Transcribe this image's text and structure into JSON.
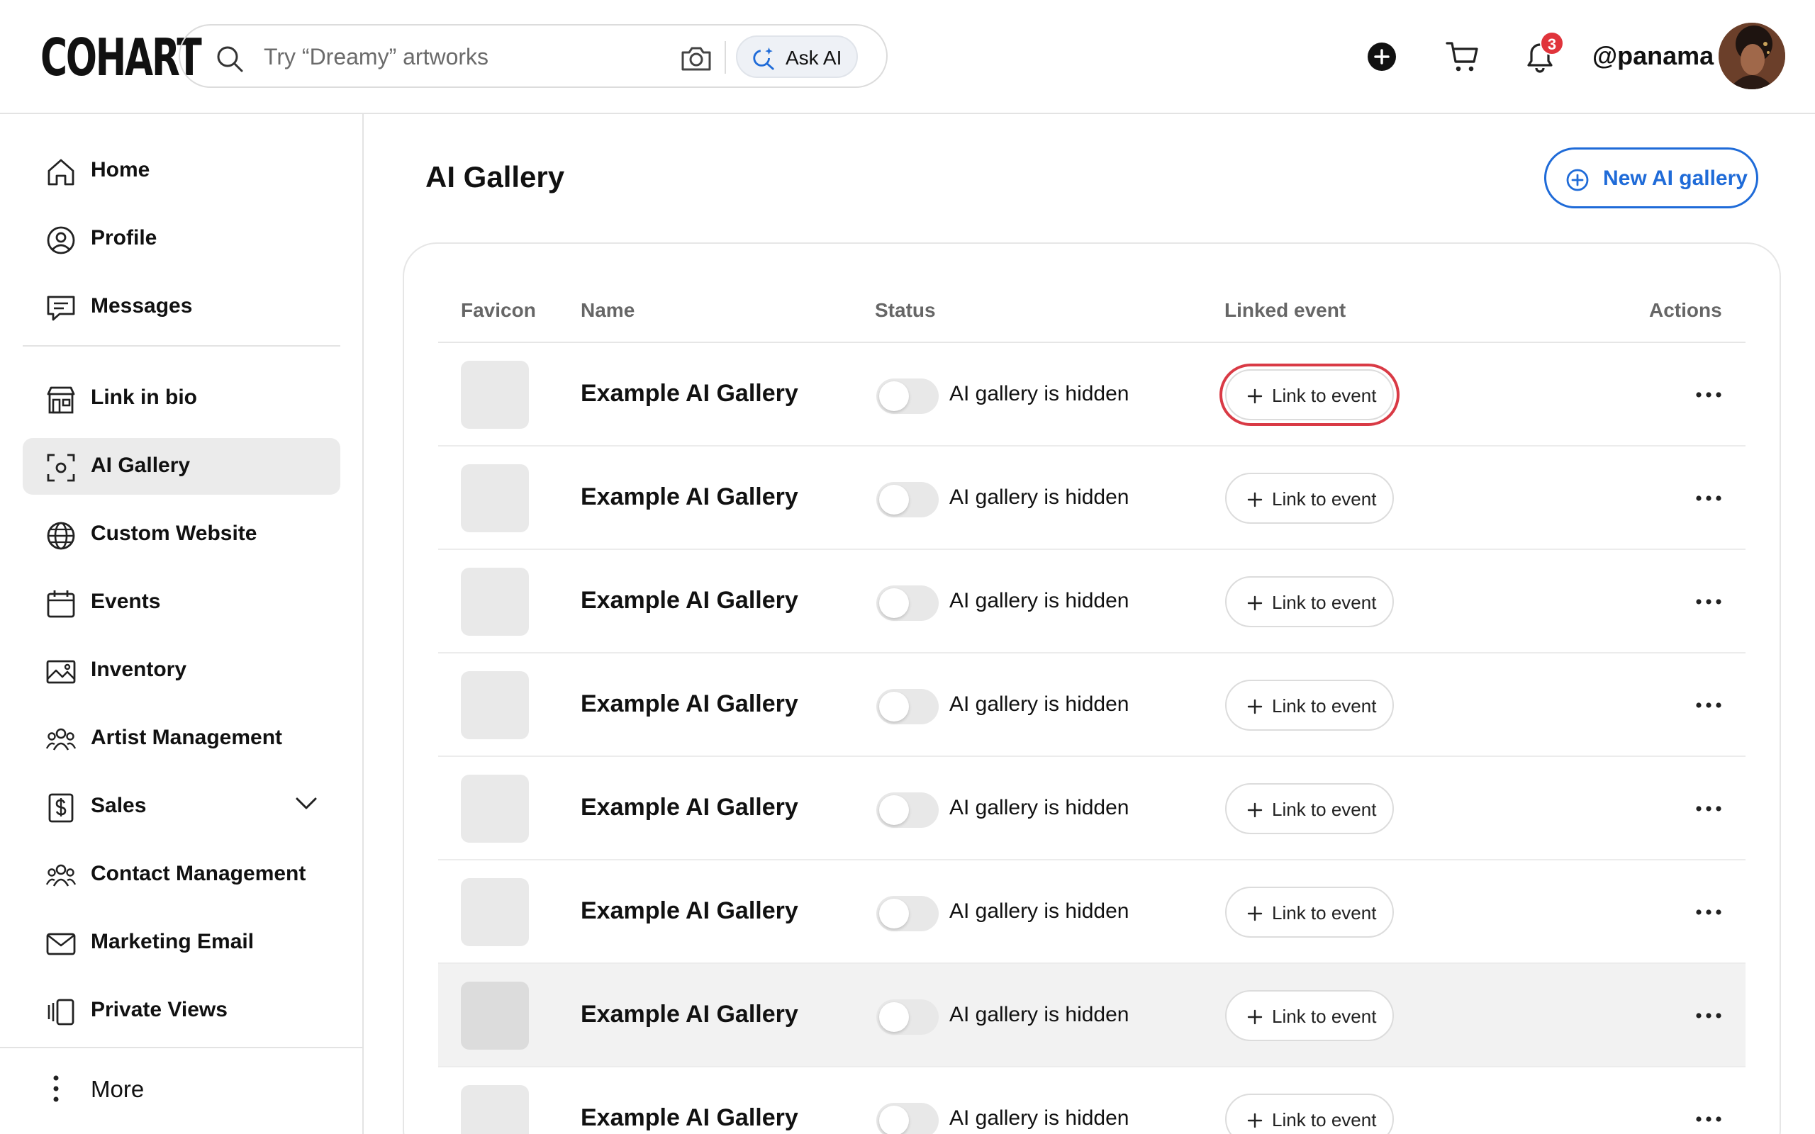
{
  "app": {
    "logo": "COHART"
  },
  "header": {
    "search_placeholder": "Try “Dreamy” artworks",
    "ask_ai_label": "Ask AI",
    "notification_count": "3",
    "username": "@panama"
  },
  "sidebar": {
    "items": [
      {
        "label": "Home",
        "icon": "home-icon"
      },
      {
        "label": "Profile",
        "icon": "profile-icon"
      },
      {
        "label": "Messages",
        "icon": "messages-icon"
      },
      {
        "label": "Link in bio",
        "icon": "storefront-icon"
      },
      {
        "label": "AI Gallery",
        "icon": "ai-scan-icon",
        "active": true
      },
      {
        "label": "Custom Website",
        "icon": "globe-icon"
      },
      {
        "label": "Events",
        "icon": "calendar-icon"
      },
      {
        "label": "Inventory",
        "icon": "image-icon"
      },
      {
        "label": "Artist Management",
        "icon": "people-icon"
      },
      {
        "label": "Sales",
        "icon": "dollar-doc-icon"
      },
      {
        "label": "Contact Management",
        "icon": "people-icon"
      },
      {
        "label": "Marketing Email",
        "icon": "mail-icon"
      },
      {
        "label": "Private Views",
        "icon": "views-icon"
      }
    ],
    "more_label": "More"
  },
  "main": {
    "title": "AI Gallery",
    "new_button_label": "New AI gallery",
    "table": {
      "columns": [
        "Favicon",
        "Name",
        "Status",
        "Linked event",
        "Actions"
      ],
      "rows": [
        {
          "name": "Example AI Gallery",
          "status": "AI gallery is hidden",
          "link_label": "Link to event"
        },
        {
          "name": "Example AI Gallery",
          "status": "AI gallery is hidden",
          "link_label": "Link to event"
        },
        {
          "name": "Example AI Gallery",
          "status": "AI gallery is hidden",
          "link_label": "Link to event"
        },
        {
          "name": "Example AI Gallery",
          "status": "AI gallery is hidden",
          "link_label": "Link to event"
        },
        {
          "name": "Example AI Gallery",
          "status": "AI gallery is hidden",
          "link_label": "Link to event"
        },
        {
          "name": "Example AI Gallery",
          "status": "AI gallery is hidden",
          "link_label": "Link to event"
        },
        {
          "name": "Example AI Gallery",
          "status": "AI gallery is hidden",
          "link_label": "Link to event"
        },
        {
          "name": "Example AI Gallery",
          "status": "AI gallery is hidden",
          "link_label": "Link to event"
        }
      ]
    }
  },
  "colors": {
    "accent": "#1f6bd8",
    "highlight_ring": "#d93a45",
    "badge": "#e0343b"
  }
}
